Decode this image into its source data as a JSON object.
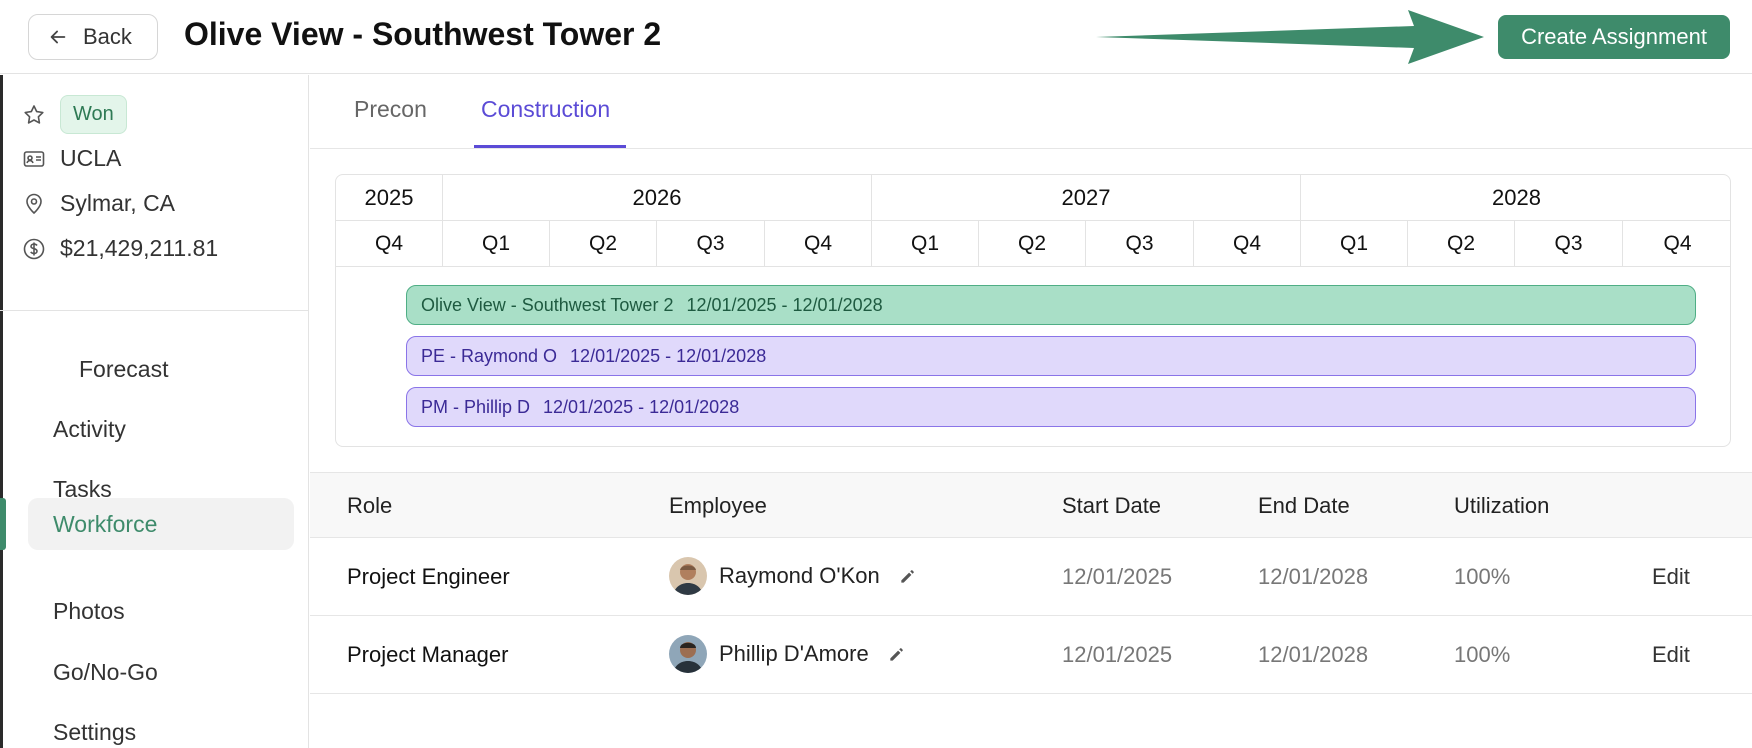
{
  "header": {
    "back_label": "Back",
    "title": "Olive View - Southwest Tower 2",
    "create_label": "Create Assignment",
    "accent": "#3e8b6b"
  },
  "sidebar": {
    "status_badge": "Won",
    "client": "UCLA",
    "location": "Sylmar, CA",
    "value": "$21,429,211.81",
    "nav": [
      {
        "label": "Forecast"
      },
      {
        "label": "Activity"
      },
      {
        "label": "Tasks"
      },
      {
        "label": "Workforce",
        "active": true
      },
      {
        "label": "Photos"
      },
      {
        "label": "Go/No-Go"
      },
      {
        "label": "Settings"
      }
    ]
  },
  "tabs": [
    {
      "label": "Precon"
    },
    {
      "label": "Construction",
      "active": true
    }
  ],
  "timeline": {
    "years": [
      "2025",
      "2026",
      "2027",
      "2028"
    ],
    "quarters": [
      "Q4",
      "Q1",
      "Q2",
      "Q3",
      "Q4",
      "Q1",
      "Q2",
      "Q3",
      "Q4",
      "Q1",
      "Q2",
      "Q3",
      "Q4"
    ],
    "bars": [
      {
        "name": "Olive View - Southwest Tower 2",
        "dates": "12/01/2025 - 12/01/2028",
        "color": "#a9dfc7"
      },
      {
        "name": "PE - Raymond O",
        "dates": "12/01/2025 - 12/01/2028",
        "color": "#e0d9fb"
      },
      {
        "name": "PM - Phillip D",
        "dates": "12/01/2025 - 12/01/2028",
        "color": "#e0d9fb"
      }
    ]
  },
  "table": {
    "columns": [
      "Role",
      "Employee",
      "Start Date",
      "End Date",
      "Utilization"
    ],
    "rows": [
      {
        "role": "Project Engineer",
        "employee": "Raymond O'Kon",
        "start": "12/01/2025",
        "end": "12/01/2028",
        "utilization": "100%",
        "action": "Edit"
      },
      {
        "role": "Project Manager",
        "employee": "Phillip D'Amore",
        "start": "12/01/2025",
        "end": "12/01/2028",
        "utilization": "100%",
        "action": "Edit"
      }
    ]
  }
}
